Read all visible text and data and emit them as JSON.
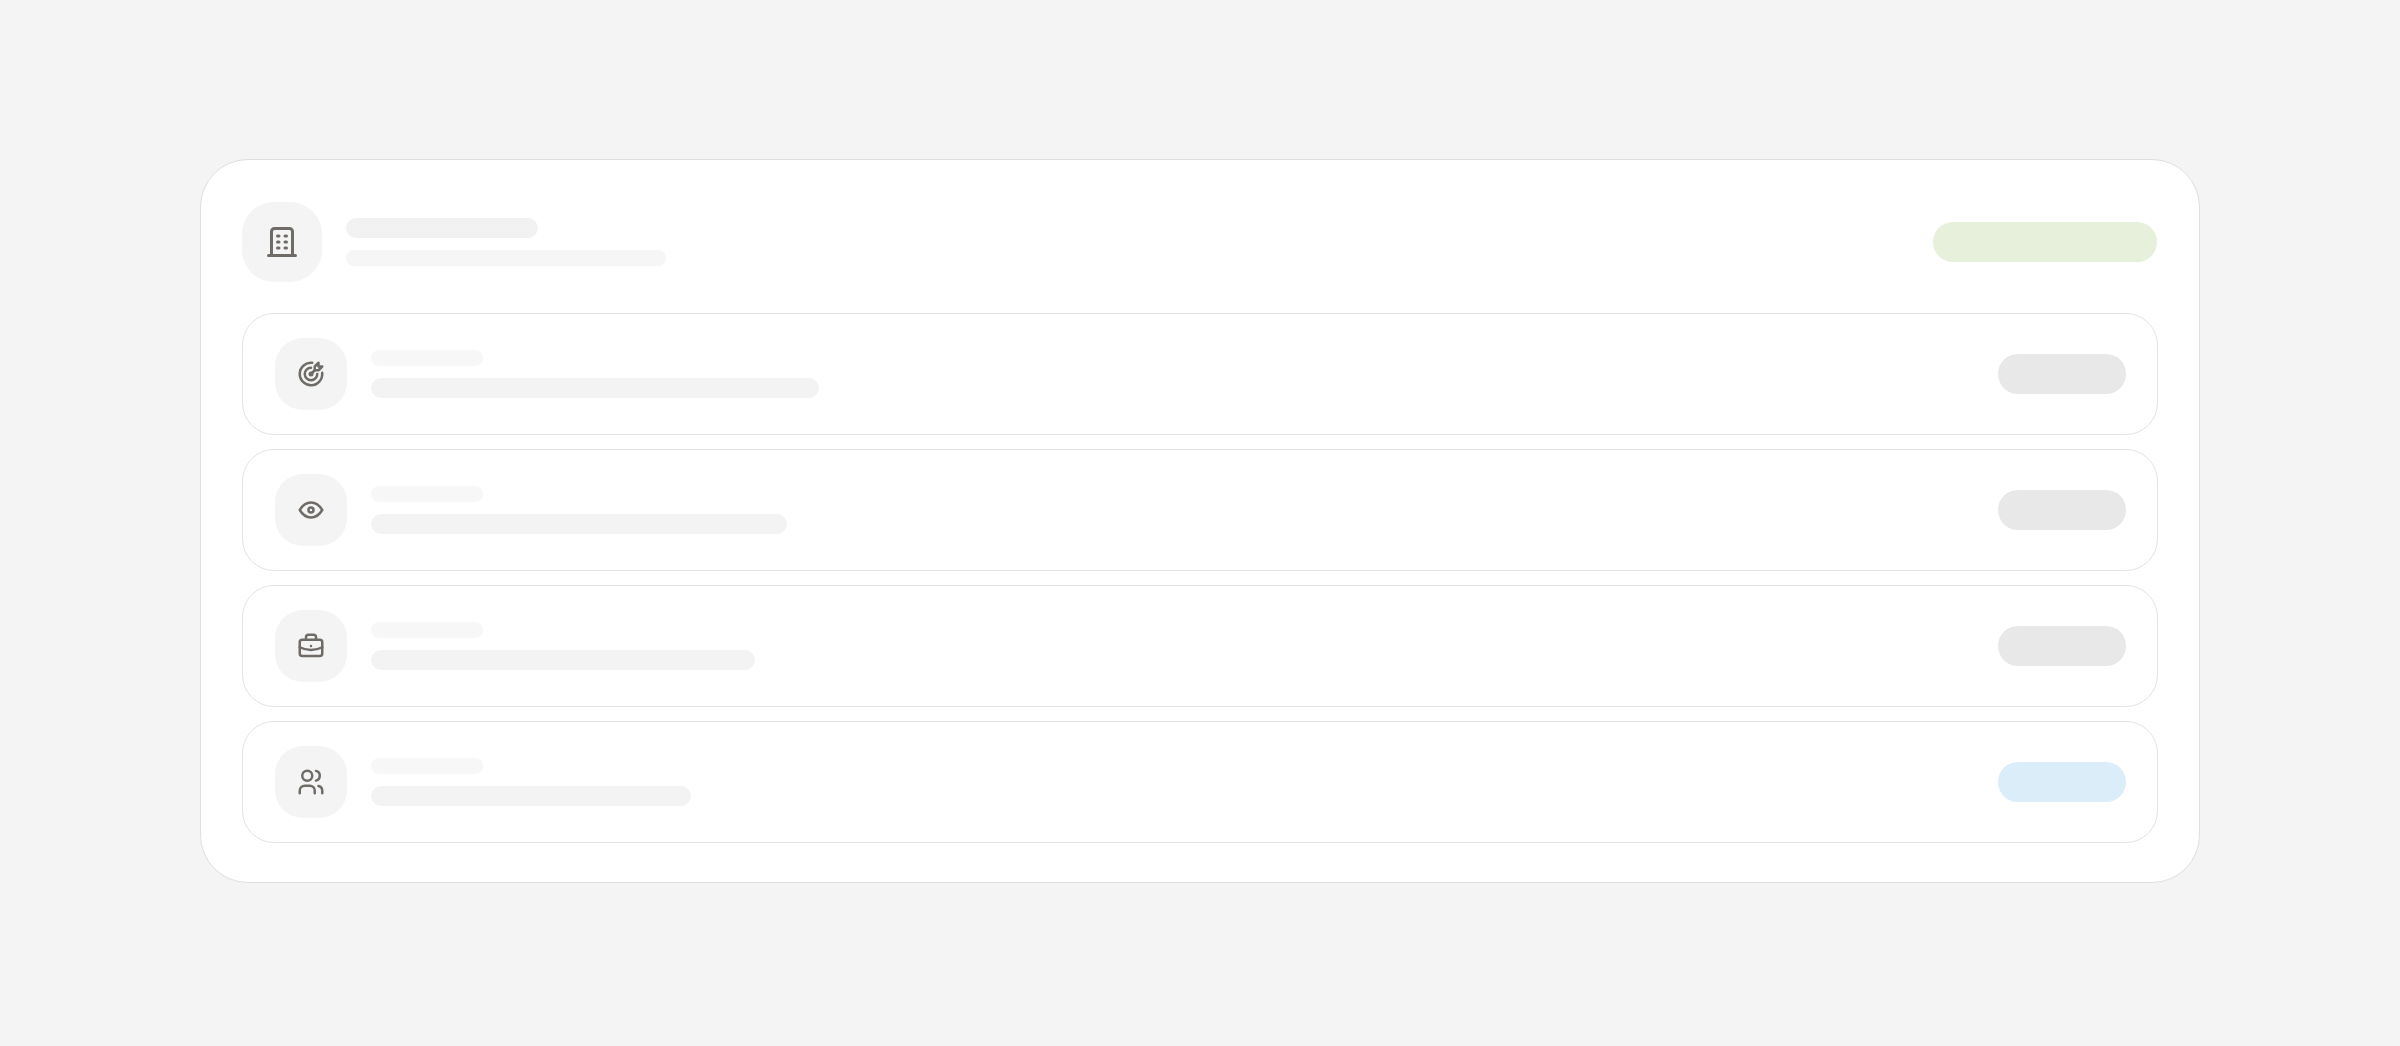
{
  "header": {
    "icon": {
      "kind": "building"
    },
    "badge": {
      "color": "#e6f0da"
    }
  },
  "items": [
    {
      "icon": {
        "kind": "target"
      },
      "badge": {
        "color": "#e8e8e8"
      }
    },
    {
      "icon": {
        "kind": "eye"
      },
      "badge": {
        "color": "#e8e8e8"
      }
    },
    {
      "icon": {
        "kind": "briefcase"
      },
      "badge": {
        "color": "#e8e8e8"
      }
    },
    {
      "icon": {
        "kind": "users"
      },
      "badge": {
        "color": "#dbedf9"
      }
    }
  ]
}
